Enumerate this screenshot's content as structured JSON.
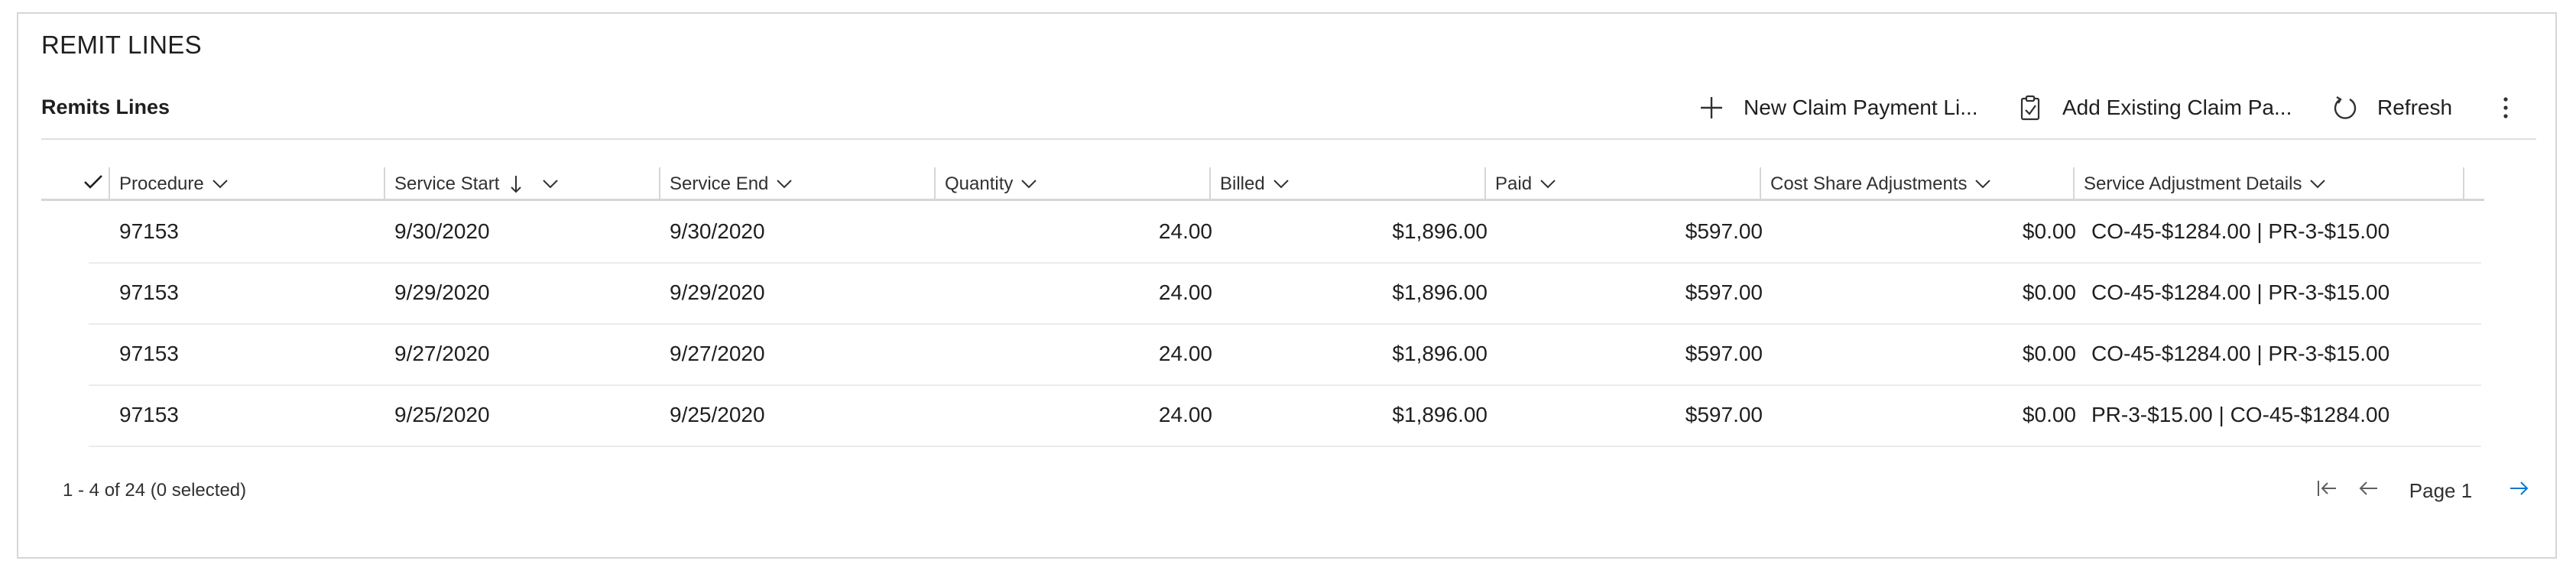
{
  "section": {
    "title": "REMIT LINES"
  },
  "grid": {
    "title": "Remits Lines"
  },
  "toolbar": {
    "new_label": "New Claim Payment Li...",
    "add_existing_label": "Add Existing Claim Pa...",
    "refresh_label": "Refresh",
    "icons": [
      "plus-icon",
      "clipboard-icon",
      "refresh-icon",
      "more-vertical-icon"
    ]
  },
  "columns": [
    {
      "label": "Procedure"
    },
    {
      "label": "Service Start"
    },
    {
      "label": "Service End"
    },
    {
      "label": "Quantity"
    },
    {
      "label": "Billed"
    },
    {
      "label": "Paid"
    },
    {
      "label": "Cost Share Adjustments"
    },
    {
      "label": "Service Adjustment Details"
    }
  ],
  "rows": [
    [
      "97153",
      "9/30/2020",
      "9/30/2020",
      "24.00",
      "$1,896.00",
      "$597.00",
      "$0.00",
      "CO-45-$1284.00 | PR-3-$15.00"
    ],
    [
      "97153",
      "9/29/2020",
      "9/29/2020",
      "24.00",
      "$1,896.00",
      "$597.00",
      "$0.00",
      "CO-45-$1284.00 | PR-3-$15.00"
    ],
    [
      "97153",
      "9/27/2020",
      "9/27/2020",
      "24.00",
      "$1,896.00",
      "$597.00",
      "$0.00",
      "CO-45-$1284.00 | PR-3-$15.00"
    ],
    [
      "97153",
      "9/25/2020",
      "9/25/2020",
      "24.00",
      "$1,896.00",
      "$597.00",
      "$0.00",
      "PR-3-$15.00 | CO-45-$1284.00"
    ]
  ],
  "footer": {
    "record_count": "1 - 4 of 24 (0 selected)",
    "page_label": "Page 1"
  },
  "colors": {
    "accent": "#0078d4",
    "border": "#d6d6d6",
    "text": "#201f1e"
  }
}
